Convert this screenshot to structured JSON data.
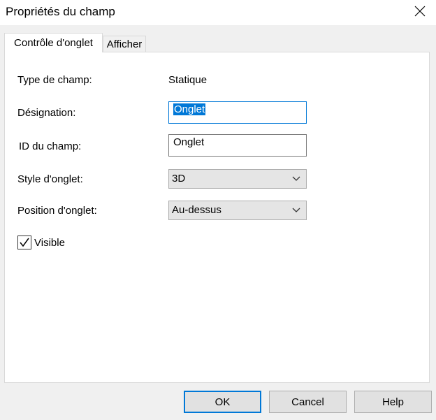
{
  "window": {
    "title": "Propriétés du champ"
  },
  "tabs": [
    {
      "label": "Contrôle d'onglet",
      "active": true
    },
    {
      "label": "Afficher",
      "active": false
    }
  ],
  "form": {
    "field_type": {
      "label": "Type de champ:",
      "value": "Statique"
    },
    "designation": {
      "label": "Désignation:",
      "value": "Onglet"
    },
    "field_id": {
      "label": "ID du champ:",
      "value": "Onglet"
    },
    "tab_style": {
      "label": "Style d'onglet:",
      "value": "3D"
    },
    "tab_position": {
      "label": "Position d'onglet:",
      "value": "Au-dessus"
    },
    "visible": {
      "label": "Visible",
      "checked": true
    }
  },
  "buttons": {
    "ok": "OK",
    "cancel": "Cancel",
    "help": "Help"
  },
  "colors": {
    "accent": "#0078d7",
    "panel": "#ffffff",
    "background": "#f0f0f0"
  }
}
